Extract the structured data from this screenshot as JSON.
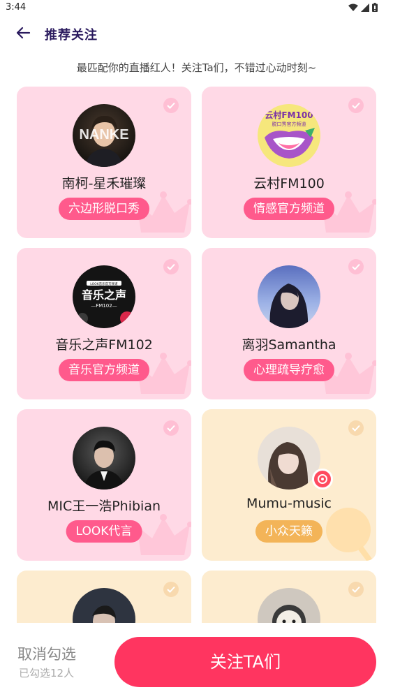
{
  "status_bar": {
    "time": "3:44"
  },
  "app_bar": {
    "title": "推荐关注"
  },
  "subtitle": "最匹配你的直播红人！关注Ta们，不错过心动时刻~",
  "cards": [
    {
      "name": "南柯-星禾璀璨",
      "tag": "六边形脱口秀",
      "theme": "pink",
      "avatar_text": "NANKE"
    },
    {
      "name": "云村FM100",
      "tag": "情感官方频道",
      "theme": "pink",
      "avatar_text": "云村FM100",
      "avatar_subtext": "脱口秀官方频道"
    },
    {
      "name": "音乐之声FM102",
      "tag": "音乐官方频道",
      "theme": "pink",
      "avatar_text": "音乐之声",
      "avatar_subtext": "—FM102—",
      "avatar_badge": "LOOK音乐官方频道"
    },
    {
      "name": "离羽Samantha",
      "tag": "心理疏导疗愈",
      "theme": "pink"
    },
    {
      "name": "MIC王一浩Phibian",
      "tag": "LOOK代言",
      "theme": "pink"
    },
    {
      "name": "Mumu-music",
      "tag": "小众天籁",
      "theme": "cream"
    },
    {
      "name": "",
      "tag": "",
      "theme": "cream"
    },
    {
      "name": "",
      "tag": "",
      "theme": "cream"
    }
  ],
  "bottom_bar": {
    "cancel_label": "取消勾选",
    "selected_count": "已勾选12人",
    "follow_button": "关注TA们"
  },
  "colors": {
    "accent": "#ff3560",
    "card_pink": "#ffd9e6",
    "card_cream": "#fdeccf",
    "tag_pink": "#ff5a8c",
    "tag_gold": "#f3b458"
  }
}
